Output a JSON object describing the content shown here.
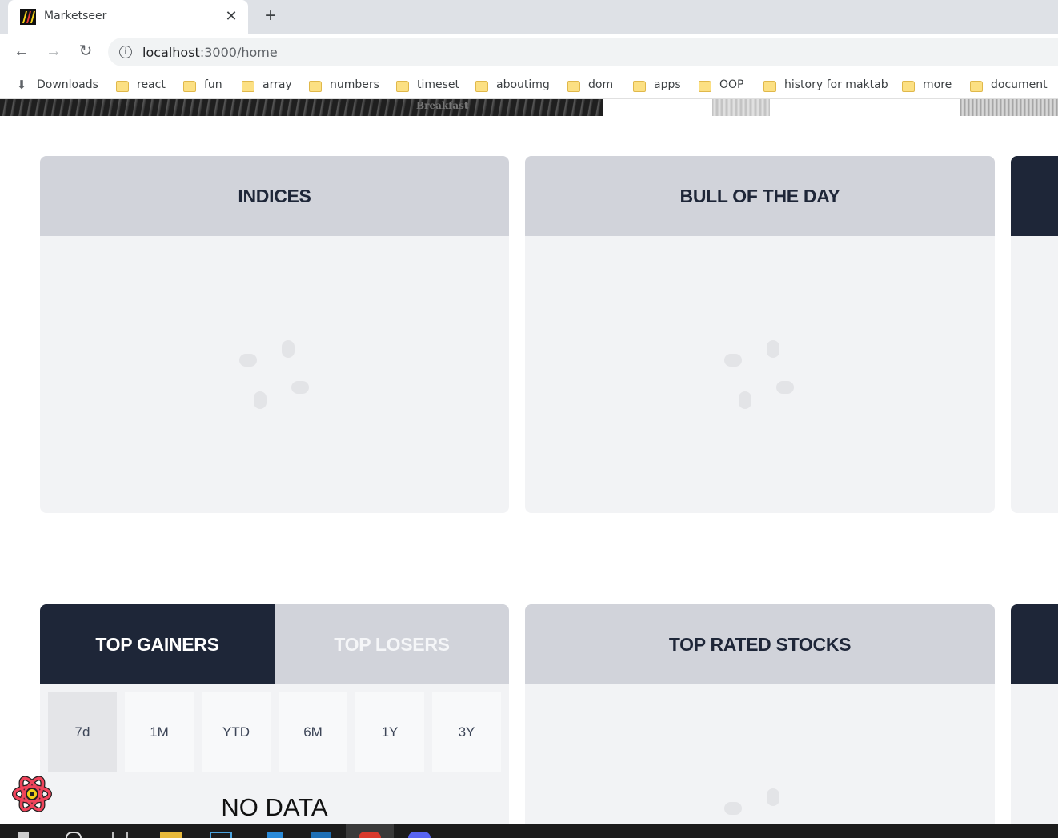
{
  "browser": {
    "tab_title": "Marketseer",
    "tab_close": "✕",
    "new_tab": "+",
    "back": "←",
    "forward": "→",
    "reload": "↻",
    "url_host": "localhost",
    "url_rest": ":3000/home"
  },
  "bookmarks": [
    {
      "label": "Downloads",
      "icon": "download-icon"
    },
    {
      "label": "react",
      "icon": "folder-icon"
    },
    {
      "label": "fun",
      "icon": "folder-icon"
    },
    {
      "label": "array",
      "icon": "folder-icon"
    },
    {
      "label": "numbers",
      "icon": "folder-icon"
    },
    {
      "label": "timeset",
      "icon": "folder-icon"
    },
    {
      "label": "aboutimg",
      "icon": "folder-icon"
    },
    {
      "label": "dom",
      "icon": "folder-icon"
    },
    {
      "label": "apps",
      "icon": "folder-icon"
    },
    {
      "label": "OOP",
      "icon": "folder-icon"
    },
    {
      "label": "history for maktab",
      "icon": "folder-icon"
    },
    {
      "label": "more",
      "icon": "folder-icon"
    },
    {
      "label": "document",
      "icon": "folder-icon"
    }
  ],
  "hero": {
    "text": "Breakfast"
  },
  "cards": {
    "indices": {
      "title": "INDICES"
    },
    "bull": {
      "title": "BULL OF THE DAY"
    },
    "gainers": {
      "tab_active": "TOP GAINERS",
      "tab_inactive": "TOP LOSERS",
      "periods": [
        "7d",
        "1M",
        "YTD",
        "6M",
        "1Y",
        "3Y"
      ],
      "empty": "NO DATA"
    },
    "top_rated": {
      "title": "TOP RATED STOCKS"
    }
  },
  "colors": {
    "header_dark": "#1e2638",
    "header_light": "#d1d3da",
    "card_bg": "#f2f3f5"
  }
}
